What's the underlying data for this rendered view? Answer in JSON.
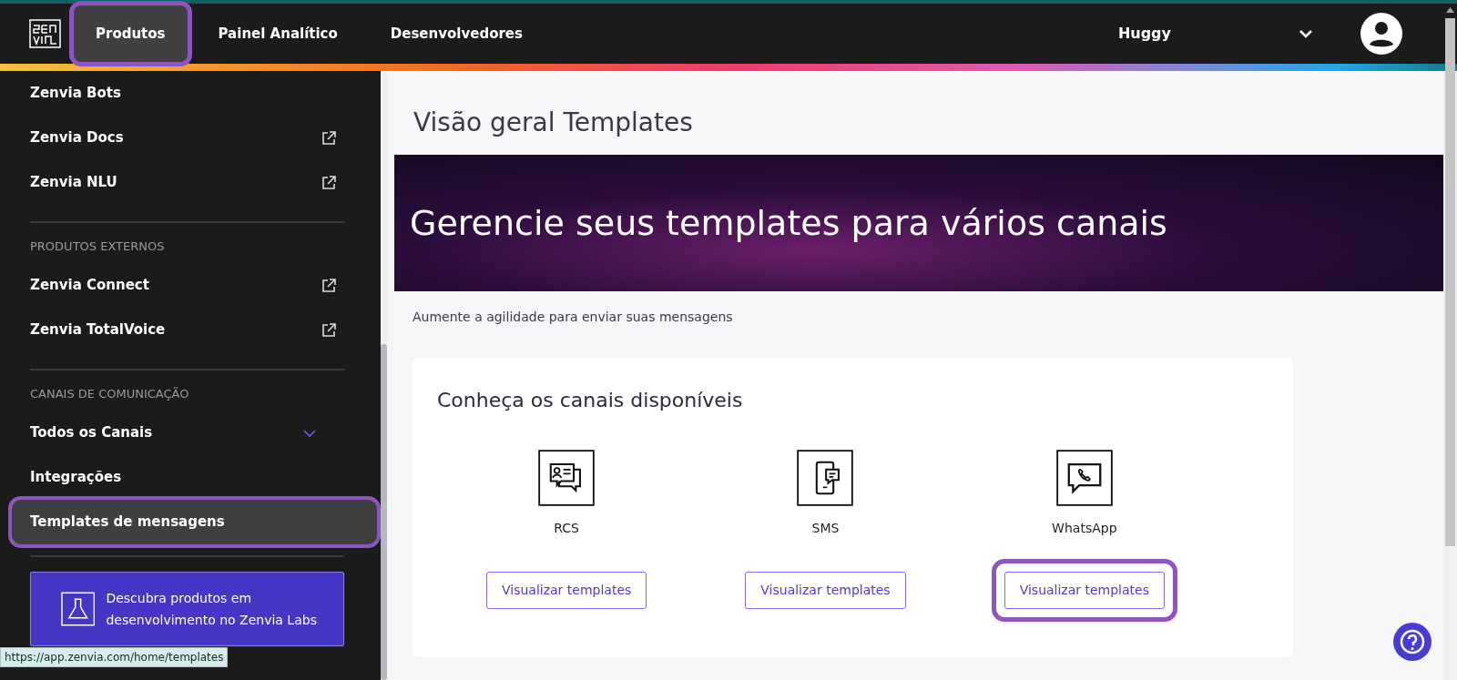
{
  "header": {
    "nav": [
      {
        "label": "Produtos",
        "selected": true,
        "highlighted": true
      },
      {
        "label": "Painel Analítico",
        "selected": false,
        "highlighted": false
      },
      {
        "label": "Desenvolvedores",
        "selected": false,
        "highlighted": false
      }
    ],
    "account": "Huggy"
  },
  "sidebar": {
    "sections": [
      {
        "items": [
          {
            "label": "Zenvia Bots",
            "kind": "plain",
            "selected": false,
            "highlighted": false
          },
          {
            "label": "Zenvia Docs",
            "kind": "external",
            "selected": false,
            "highlighted": false
          },
          {
            "label": "Zenvia NLU",
            "kind": "external",
            "selected": false,
            "highlighted": false
          }
        ]
      },
      {
        "heading": "PRODUTOS EXTERNOS",
        "items": [
          {
            "label": "Zenvia Connect",
            "kind": "external",
            "selected": false,
            "highlighted": false
          },
          {
            "label": "Zenvia TotalVoice",
            "kind": "external",
            "selected": false,
            "highlighted": false
          }
        ]
      },
      {
        "heading": "CANAIS DE COMUNICAÇÃO",
        "items": [
          {
            "label": "Todos os Canais",
            "kind": "expandable",
            "expanded": false,
            "selected": false,
            "highlighted": false
          },
          {
            "label": "Integrações",
            "kind": "plain",
            "selected": false,
            "highlighted": false
          },
          {
            "label": "Templates de mensagens",
            "kind": "plain",
            "selected": true,
            "highlighted": true
          }
        ]
      }
    ],
    "labs_banner": "Descubra produtos em desenvolvimento no Zenvia Labs"
  },
  "status_url": "https://app.zenvia.com/home/templates",
  "main": {
    "title": "Visão geral Templates",
    "banner": "Gerencie seus templates para vários canais",
    "subtitle": "Aumente a agilidade para enviar suas mensagens",
    "card": {
      "title": "Conheça os canais disponíveis",
      "channels": [
        {
          "kind": "rcs",
          "name": "RCS",
          "button": "Visualizar templates",
          "highlighted": false
        },
        {
          "kind": "sms",
          "name": "SMS",
          "button": "Visualizar templates",
          "highlighted": false
        },
        {
          "kind": "whatsapp",
          "name": "WhatsApp",
          "button": "Visualizar templates",
          "highlighted": true
        }
      ]
    }
  }
}
